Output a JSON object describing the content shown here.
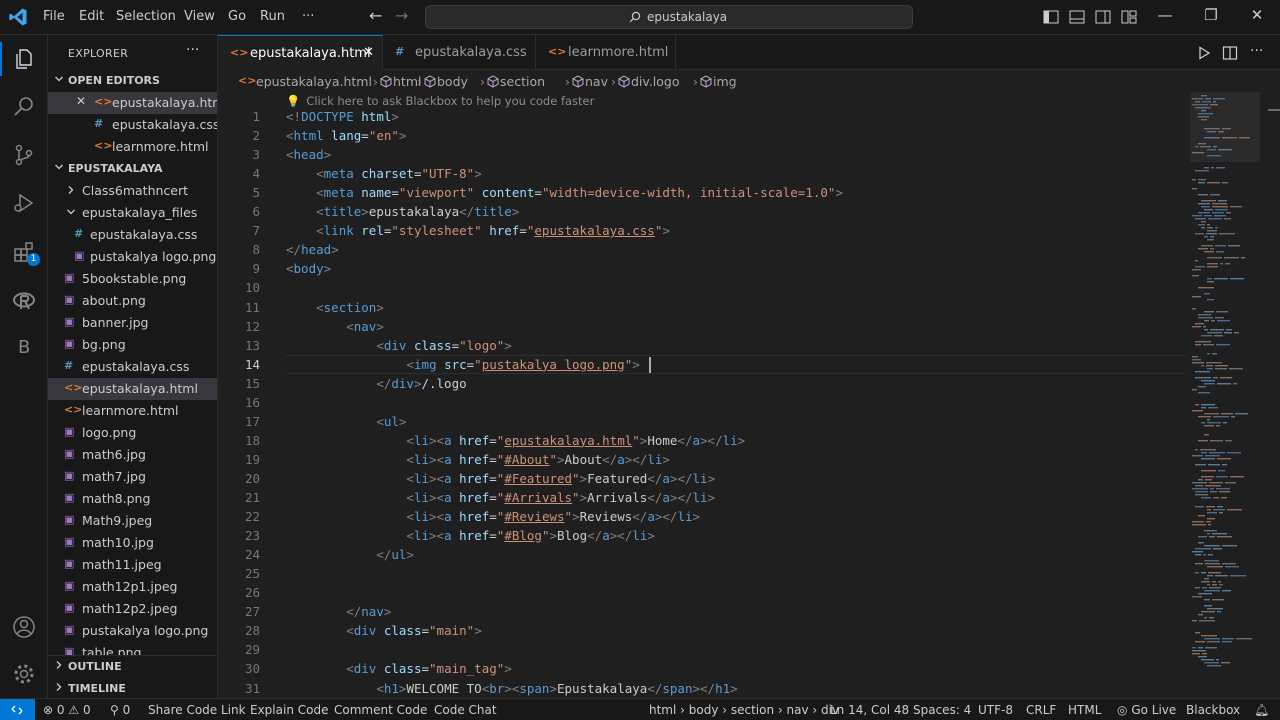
{
  "titlebar": {
    "menu": [
      "File",
      "Edit",
      "Selection",
      "View",
      "Go",
      "Run",
      "···"
    ],
    "search_text": "epustakalaya",
    "window_controls": [
      "minimize",
      "restore",
      "close"
    ]
  },
  "activity": {
    "extensions_badge": "1",
    "letter_item": "B"
  },
  "sidebar": {
    "title": "EXPLORER",
    "more": "···",
    "open_editors_label": "OPEN EDITORS",
    "open_editors": [
      {
        "name": "epustakalaya.html",
        "type": "html"
      },
      {
        "name": "epustakalaya.css",
        "type": "css"
      },
      {
        "name": "learnmore.html",
        "type": "html"
      }
    ],
    "folder_label": "EPUSTAKALAYA",
    "tree": [
      {
        "name": "Class6mathncert",
        "type": "folder-closed",
        "depth": 1
      },
      {
        "name": "epustakalaya_files",
        "type": "folder-open",
        "depth": 1
      },
      {
        "name": "epustakalaya.css",
        "type": "css",
        "depth": 2
      },
      {
        "name": "pustakalya logo.png",
        "type": "png",
        "depth": 2
      },
      {
        "name": "5bookstable.png",
        "type": "png",
        "depth": 1
      },
      {
        "name": "about.png",
        "type": "png",
        "depth": 1
      },
      {
        "name": "banner.jpg",
        "type": "png",
        "depth": 1
      },
      {
        "name": "bg.png",
        "type": "png",
        "depth": 1
      },
      {
        "name": "epustakalaya.css",
        "type": "css",
        "depth": 1
      },
      {
        "name": "epustakalaya.html",
        "type": "html",
        "depth": 1
      },
      {
        "name": "learnmore.html",
        "type": "html",
        "depth": 1
      },
      {
        "name": "logo.png",
        "type": "png",
        "depth": 1
      },
      {
        "name": "math6.jpg",
        "type": "png",
        "depth": 1
      },
      {
        "name": "math7.jpg",
        "type": "png",
        "depth": 1
      },
      {
        "name": "math8.png",
        "type": "png",
        "depth": 1
      },
      {
        "name": "Math9.jpeg",
        "type": "png",
        "depth": 1
      },
      {
        "name": "math10.jpg",
        "type": "png",
        "depth": 1
      },
      {
        "name": "math11.jpeg",
        "type": "png",
        "depth": 1
      },
      {
        "name": "math12p1.jpeg",
        "type": "png",
        "depth": 1
      },
      {
        "name": "math12p2.jpeg",
        "type": "png",
        "depth": 1
      },
      {
        "name": "pustakalya logo.png",
        "type": "png",
        "depth": 1
      },
      {
        "name": "table.png",
        "type": "png",
        "depth": 1
      }
    ],
    "outline_label": "OUTLINE",
    "timeline_label": "TIMELINE"
  },
  "tabs": [
    {
      "name": "epustakalaya.html",
      "type": "html",
      "active": true
    },
    {
      "name": "epustakalaya.css",
      "type": "css",
      "active": false
    },
    {
      "name": "learnmore.html",
      "type": "html",
      "active": false
    }
  ],
  "breadcrumb": [
    "epustakalaya.html",
    "html",
    "body",
    "section",
    "nav",
    "div.logo",
    "img"
  ],
  "editor": {
    "hint": "Click here to ask Blackbox to help you code faster",
    "current_line": 14,
    "lines": [
      [
        [
          "tg",
          "<!"
        ],
        [
          "tn",
          "DOCTYPE"
        ],
        [
          "tx",
          " "
        ],
        [
          "at",
          "html"
        ],
        [
          "tg",
          ">"
        ]
      ],
      [
        [
          "tg",
          "<"
        ],
        [
          "tn",
          "html"
        ],
        [
          "tx",
          " "
        ],
        [
          "at",
          "lang"
        ],
        [
          "tx",
          "="
        ],
        [
          "sv",
          "\"en\""
        ],
        [
          "tg",
          ">"
        ]
      ],
      [
        [
          "tg",
          "<"
        ],
        [
          "tn",
          "head"
        ],
        [
          "tg",
          ">"
        ]
      ],
      [
        [
          "tx",
          "    "
        ],
        [
          "tg",
          "<"
        ],
        [
          "tn",
          "meta"
        ],
        [
          "tx",
          " "
        ],
        [
          "at",
          "charset"
        ],
        [
          "tx",
          "="
        ],
        [
          "sv",
          "\"UTF-8\""
        ],
        [
          "tg",
          ">"
        ]
      ],
      [
        [
          "tx",
          "    "
        ],
        [
          "tg",
          "<"
        ],
        [
          "tn",
          "meta"
        ],
        [
          "tx",
          " "
        ],
        [
          "at",
          "name"
        ],
        [
          "tx",
          "="
        ],
        [
          "sv",
          "\"viewport\""
        ],
        [
          "tx",
          " "
        ],
        [
          "at",
          "content"
        ],
        [
          "tx",
          "="
        ],
        [
          "sv",
          "\"width=device-width, initial-scale=1.0\""
        ],
        [
          "tg",
          ">"
        ]
      ],
      [
        [
          "tx",
          "    "
        ],
        [
          "tg",
          "<"
        ],
        [
          "tn",
          "title"
        ],
        [
          "tg",
          ">"
        ],
        [
          "tx",
          "epustakalaya"
        ],
        [
          "tg",
          "</"
        ],
        [
          "tn",
          "title"
        ],
        [
          "tg",
          ">"
        ]
      ],
      [
        [
          "tx",
          "    "
        ],
        [
          "tg",
          "<"
        ],
        [
          "tn",
          "link"
        ],
        [
          "tx",
          " "
        ],
        [
          "at",
          "rel"
        ],
        [
          "tx",
          "="
        ],
        [
          "sv",
          "\"stylesheet\""
        ],
        [
          "tx",
          " "
        ],
        [
          "at",
          "href"
        ],
        [
          "tx",
          "="
        ],
        [
          "sv",
          "\""
        ],
        [
          "svu",
          "epustakalaya.css"
        ],
        [
          "sv",
          "\""
        ],
        [
          "tg",
          ">"
        ]
      ],
      [
        [
          "tg",
          "</"
        ],
        [
          "tn",
          "head"
        ],
        [
          "tg",
          ">"
        ]
      ],
      [
        [
          "tg",
          "<"
        ],
        [
          "tn",
          "body"
        ],
        [
          "tg",
          ">"
        ]
      ],
      [],
      [
        [
          "tx",
          "    "
        ],
        [
          "tg",
          "<"
        ],
        [
          "tn",
          "section"
        ],
        [
          "tg",
          ">"
        ]
      ],
      [
        [
          "tx",
          "        "
        ],
        [
          "tg",
          "<"
        ],
        [
          "tn",
          "nav"
        ],
        [
          "tg",
          ">"
        ]
      ],
      [
        [
          "tx",
          "            "
        ],
        [
          "tg",
          "<"
        ],
        [
          "tn",
          "div"
        ],
        [
          "tx",
          " "
        ],
        [
          "at",
          "class"
        ],
        [
          "tx",
          "="
        ],
        [
          "sv",
          "\"logo\""
        ],
        [
          "tg",
          ">"
        ]
      ],
      [
        [
          "tx",
          "                "
        ],
        [
          "tg",
          "<"
        ],
        [
          "tn",
          "img"
        ],
        [
          "tx",
          " "
        ],
        [
          "at",
          "src"
        ],
        [
          "tx",
          "="
        ],
        [
          "sv",
          "\""
        ],
        [
          "svu",
          "pustakalya logo.png"
        ],
        [
          "sv",
          "\""
        ],
        [
          "tg",
          ">"
        ]
      ],
      [
        [
          "tx",
          "            "
        ],
        [
          "tg",
          "</"
        ],
        [
          "tn",
          "div"
        ],
        [
          "tg",
          ">"
        ],
        [
          "tx",
          "/.logo"
        ]
      ],
      [],
      [
        [
          "tx",
          "            "
        ],
        [
          "tg",
          "<"
        ],
        [
          "tn",
          "ul"
        ],
        [
          "tg",
          ">"
        ]
      ],
      [
        [
          "tx",
          "                "
        ],
        [
          "tg",
          "<"
        ],
        [
          "tn",
          "li"
        ],
        [
          "tg",
          "><"
        ],
        [
          "tn",
          "a"
        ],
        [
          "tx",
          " "
        ],
        [
          "at",
          "href"
        ],
        [
          "tx",
          "="
        ],
        [
          "sv",
          "\""
        ],
        [
          "svu",
          "epustakalaya.html"
        ],
        [
          "sv",
          "\""
        ],
        [
          "tg",
          ">"
        ],
        [
          "tx",
          "Home"
        ],
        [
          "tg",
          "</"
        ],
        [
          "tn",
          "a"
        ],
        [
          "tg",
          "></"
        ],
        [
          "tn",
          "li"
        ],
        [
          "tg",
          ">"
        ]
      ],
      [
        [
          "tx",
          "                "
        ],
        [
          "tg",
          "<"
        ],
        [
          "tn",
          "li"
        ],
        [
          "tg",
          "><"
        ],
        [
          "tn",
          "a"
        ],
        [
          "tx",
          " "
        ],
        [
          "at",
          "href"
        ],
        [
          "tx",
          "="
        ],
        [
          "sv",
          "\""
        ],
        [
          "svu",
          "#About"
        ],
        [
          "sv",
          "\""
        ],
        [
          "tg",
          ">"
        ],
        [
          "tx",
          "About"
        ],
        [
          "tg",
          "</"
        ],
        [
          "tn",
          "a"
        ],
        [
          "tg",
          "></"
        ],
        [
          "tn",
          "li"
        ],
        [
          "tg",
          ">"
        ]
      ],
      [
        [
          "tx",
          "                "
        ],
        [
          "tg",
          "<"
        ],
        [
          "tn",
          "li"
        ],
        [
          "tg",
          "><"
        ],
        [
          "tn",
          "a"
        ],
        [
          "tx",
          " "
        ],
        [
          "at",
          "href"
        ],
        [
          "tx",
          "="
        ],
        [
          "sv",
          "\""
        ],
        [
          "svu",
          "#Featured"
        ],
        [
          "sv",
          "\""
        ],
        [
          "tg",
          ">"
        ],
        [
          "tx",
          "Featured"
        ],
        [
          "tg",
          "</"
        ],
        [
          "tn",
          "a"
        ],
        [
          "tg",
          "></"
        ],
        [
          "tn",
          "li"
        ],
        [
          "tg",
          ">"
        ]
      ],
      [
        [
          "tx",
          "                "
        ],
        [
          "tg",
          "<"
        ],
        [
          "tn",
          "li"
        ],
        [
          "tg",
          "><"
        ],
        [
          "tn",
          "a"
        ],
        [
          "tx",
          " "
        ],
        [
          "at",
          "href"
        ],
        [
          "tx",
          "="
        ],
        [
          "sv",
          "\""
        ],
        [
          "svu",
          "#Arrivals"
        ],
        [
          "sv",
          "\""
        ],
        [
          "tg",
          ">"
        ],
        [
          "tx",
          "Arrivals"
        ],
        [
          "tg",
          "</"
        ],
        [
          "tn",
          "a"
        ],
        [
          "tg",
          "></"
        ],
        [
          "tn",
          "li"
        ],
        [
          "tg",
          ">"
        ]
      ],
      [
        [
          "tx",
          "                "
        ],
        [
          "tg",
          "<"
        ],
        [
          "tn",
          "li"
        ],
        [
          "tg",
          "><"
        ],
        [
          "tn",
          "a"
        ],
        [
          "tx",
          " "
        ],
        [
          "at",
          "href"
        ],
        [
          "tx",
          "="
        ],
        [
          "sv",
          "\""
        ],
        [
          "svu",
          "#Reviews"
        ],
        [
          "sv",
          "\""
        ],
        [
          "tg",
          ">"
        ],
        [
          "tx",
          "Reviews"
        ],
        [
          "tg",
          "</"
        ],
        [
          "tn",
          "a"
        ],
        [
          "tg",
          "></"
        ],
        [
          "tn",
          "li"
        ],
        [
          "tg",
          ">"
        ]
      ],
      [
        [
          "tx",
          "                "
        ],
        [
          "tg",
          "<"
        ],
        [
          "tn",
          "li"
        ],
        [
          "tg",
          "><"
        ],
        [
          "tn",
          "a"
        ],
        [
          "tx",
          " "
        ],
        [
          "at",
          "href"
        ],
        [
          "tx",
          "="
        ],
        [
          "sv",
          "\""
        ],
        [
          "svu",
          "#Blog"
        ],
        [
          "sv",
          "\""
        ],
        [
          "tg",
          ">"
        ],
        [
          "tx",
          "Blog"
        ],
        [
          "tg",
          "</"
        ],
        [
          "tn",
          "a"
        ],
        [
          "tg",
          "></"
        ],
        [
          "tn",
          "li"
        ],
        [
          "tg",
          ">"
        ]
      ],
      [
        [
          "tx",
          "            "
        ],
        [
          "tg",
          "</"
        ],
        [
          "tn",
          "ul"
        ],
        [
          "tg",
          ">"
        ]
      ],
      [],
      [],
      [
        [
          "tx",
          "        "
        ],
        [
          "tg",
          "</"
        ],
        [
          "tn",
          "nav"
        ],
        [
          "tg",
          ">"
        ]
      ],
      [
        [
          "tx",
          "        "
        ],
        [
          "tg",
          "<"
        ],
        [
          "tn",
          "div"
        ],
        [
          "tx",
          " "
        ],
        [
          "at",
          "class"
        ],
        [
          "tx",
          "="
        ],
        [
          "sv",
          "\"main\""
        ],
        [
          "tg",
          ">"
        ]
      ],
      [],
      [
        [
          "tx",
          "        "
        ],
        [
          "tg",
          "<"
        ],
        [
          "tn",
          "div"
        ],
        [
          "tx",
          " "
        ],
        [
          "at",
          "class"
        ],
        [
          "tx",
          "="
        ],
        [
          "sv",
          "\"main_tag\""
        ],
        [
          "tg",
          ">"
        ]
      ],
      [
        [
          "tx",
          "            "
        ],
        [
          "tg",
          "<"
        ],
        [
          "tn",
          "h1"
        ],
        [
          "tg",
          ">"
        ],
        [
          "tx",
          "WELCOME TO"
        ],
        [
          "tg",
          "<"
        ],
        [
          "tn",
          "br"
        ],
        [
          "tg",
          "><"
        ],
        [
          "tn",
          "span"
        ],
        [
          "tg",
          ">"
        ],
        [
          "tx",
          "Epustakalaya"
        ],
        [
          "tg",
          "</"
        ],
        [
          "tn",
          "span"
        ],
        [
          "tg",
          "></"
        ],
        [
          "tn",
          "h1"
        ],
        [
          "tg",
          ">"
        ]
      ]
    ]
  },
  "statusbar": {
    "problems": "0",
    "warnings": "0",
    "ports": "0",
    "items_left": [
      "Share Code Link",
      "Explain Code",
      "Comment Code",
      "Code Chat"
    ],
    "path": "html › body › section › nav › div",
    "position": "Ln 14, Col 48",
    "spaces": "Spaces: 4",
    "encoding": "UTF-8",
    "eol": "CRLF",
    "language": "HTML",
    "golive": "Go Live",
    "blackbox": "Blackbox"
  },
  "colors": {
    "accent": "#0078d4",
    "background": "#1f1f1f",
    "chrome": "#181818"
  }
}
